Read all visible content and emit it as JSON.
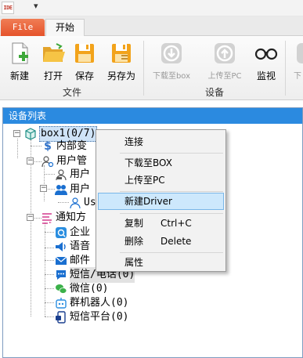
{
  "app": {
    "icon_text": "IDE",
    "quick_access_arrow": "▾"
  },
  "tabs": {
    "file": "File",
    "start": "开始"
  },
  "ribbon": {
    "file_buttons": [
      {
        "label": "新建",
        "icon": "new-icon"
      },
      {
        "label": "打开",
        "icon": "open-folder-icon"
      },
      {
        "label": "保存",
        "icon": "save-icon"
      },
      {
        "label": "另存为",
        "icon": "save-as-icon"
      }
    ],
    "file_group": "文件",
    "device_buttons": [
      {
        "label": "下载至box",
        "icon": "download-icon",
        "enabled": false
      },
      {
        "label": "上传至PC",
        "icon": "upload-icon",
        "enabled": false
      },
      {
        "label": "监视",
        "icon": "glasses-icon",
        "enabled": true
      }
    ],
    "device_group": "设备",
    "overflow_label": "下"
  },
  "panel": {
    "title": "设备列表"
  },
  "tree": {
    "root": "box1(0/7)",
    "items": [
      {
        "label": "内部变",
        "icon": "dollar-icon"
      },
      {
        "label": "用户管",
        "icon": "user-manage-icon"
      },
      {
        "label": "用户",
        "icon": "user-icon"
      },
      {
        "label": "用户",
        "icon": "users-icon"
      },
      {
        "label": "Us",
        "icon": "user-outline-icon"
      },
      {
        "label": "通知方",
        "icon": "notify-icon"
      },
      {
        "label": "企业",
        "icon": "enterprise-icon"
      },
      {
        "label": "语音",
        "icon": "voice-icon"
      },
      {
        "label": "邮件",
        "icon": "mail-icon"
      },
      {
        "label": "短信/电话(0)",
        "icon": "sms-phone-icon"
      },
      {
        "label": "微信(0)",
        "icon": "wechat-icon"
      },
      {
        "label": "群机器人(0)",
        "icon": "robot-icon"
      },
      {
        "label": "短信平台(0)",
        "icon": "sms-platform-icon"
      }
    ]
  },
  "context_menu": {
    "connect": "连接",
    "download": "下载至BOX",
    "upload": "上传至PC",
    "new_driver": "新建Driver",
    "copy": "复制",
    "copy_shortcut": "Ctrl+C",
    "delete": "删除",
    "delete_shortcut": "Delete",
    "properties": "属性"
  },
  "colors": {
    "file_tab": "#e5532b",
    "panel_header": "#2b8ae0",
    "menu_highlight": "#cde8fc"
  }
}
